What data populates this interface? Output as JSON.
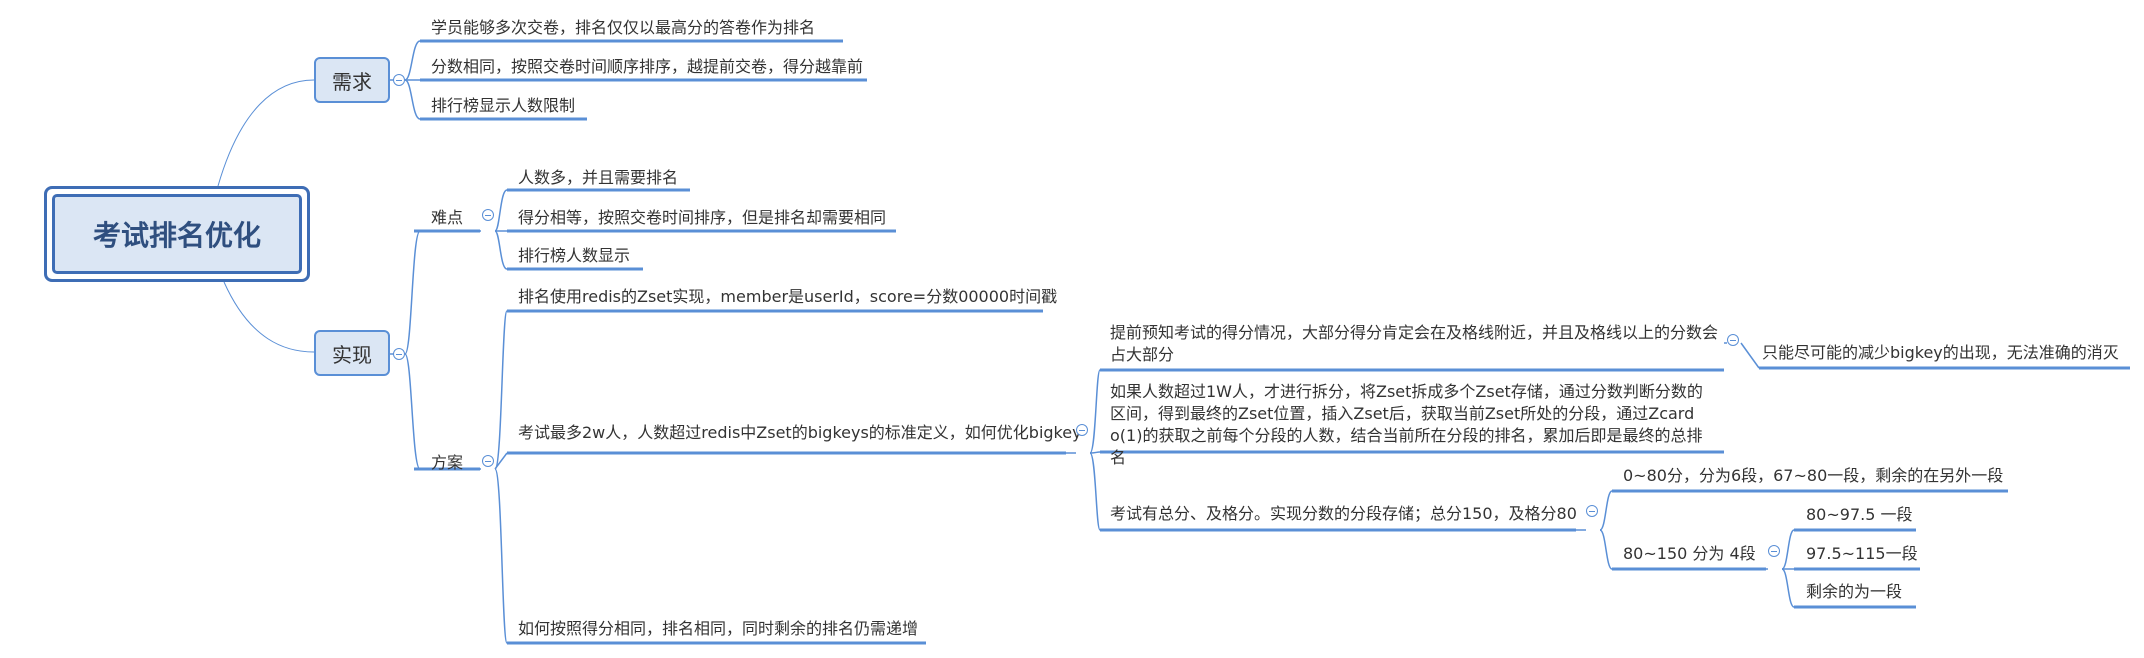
{
  "root": {
    "title": "考试排名优化"
  },
  "branches": {
    "xuqiu": {
      "label": "需求",
      "items": [
        "学员能够多次交卷，排名仅仅以最高分的答卷作为排名",
        "分数相同，按照交卷时间顺序排序，越提前交卷，得分越靠前",
        "排行榜显示人数限制"
      ]
    },
    "shixian": {
      "label": "实现",
      "nandian": {
        "label": "难点",
        "items": [
          "人数多，并且需要排名",
          "得分相等，按照交卷时间排序，但是排名却需要相同",
          "排行榜人数显示"
        ]
      },
      "fangan": {
        "label": "方案",
        "zset": "排名使用redis的Zset实现，member是userId，score=分数00000时间戳",
        "bigkey": {
          "label": "考试最多2w人，人数超过redis中Zset的bigkeys的标准定义，如何优化bigkey",
          "predict": "提前预知考试的得分情况，大部分得分肯定会在及格线附近，并且及格线以上的分数会占大部分",
          "predict_note": "只能尽可能的减少bigkey的出现，无法准确的消灭",
          "split": "如果人数超过1W人，才进行拆分，将Zset拆成多个Zset存储，通过分数判断分数的区间，得到最终的Zset位置，插入Zset后，获取当前Zset所处的分段，通过Zcard o(1)的获取之前每个分段的人数，结合当前所在分段的排名，累加后即是最终的总排名",
          "segment": {
            "label": "考试有总分、及格分。实现分数的分段存储；总分150，及格分80",
            "low": "0~80分，分为6段，67~80一段，剩余的在另外一段",
            "high": {
              "label": "80~150 分为 4段",
              "items": [
                "80~97.5 一段",
                "97.5~115一段",
                "剩余的为一段"
              ]
            }
          }
        },
        "tie": "如何按照得分相同，排名相同，同时剩余的排名仍需递增"
      }
    }
  },
  "colors": {
    "line": "#5a8fd6",
    "box_fill": "#dbe6f4",
    "root_border": "#3e6db5",
    "text": "#333333"
  }
}
